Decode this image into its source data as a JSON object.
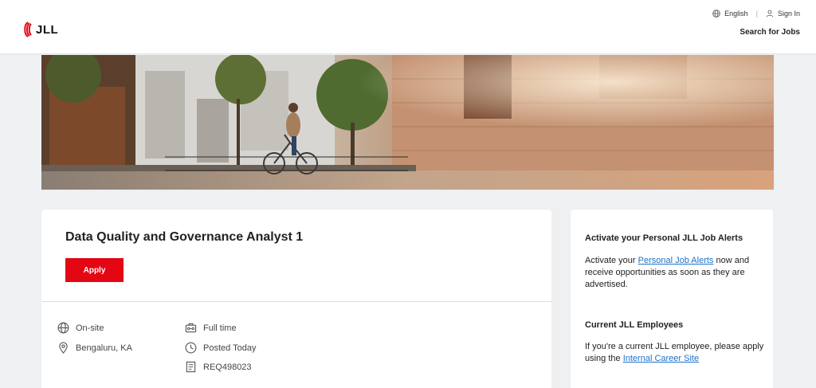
{
  "header": {
    "logo_text": "JLL",
    "language_label": "English",
    "signin_label": "Sign In",
    "search_jobs_label": "Search for Jobs"
  },
  "job": {
    "title": "Data Quality and Governance Analyst 1",
    "apply_label": "Apply",
    "work_mode": "On-site",
    "location": "Bengaluru, KA",
    "employment_type": "Full time",
    "posted": "Posted Today",
    "requisition": "REQ498023"
  },
  "sidebar": {
    "alerts_heading": "Activate your Personal JLL Job Alerts",
    "alerts_text_before": "Activate your ",
    "alerts_link": "Personal Job Alerts",
    "alerts_text_after": " now and receive opportunities as soon as they are advertised.",
    "employees_heading": "Current JLL Employees",
    "employees_text_before": "If you're a current JLL employee, please apply using the ",
    "employees_link": "Internal Career Site"
  },
  "colors": {
    "brand_red": "#e30613",
    "link_blue": "#1a73c8",
    "page_bg": "#eef0f2"
  }
}
